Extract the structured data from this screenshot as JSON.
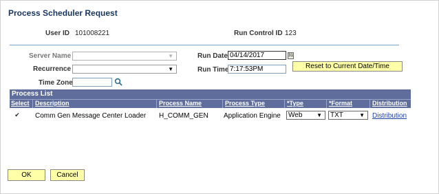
{
  "title": "Process Scheduler Request",
  "header": {
    "user_id_label": "User ID",
    "user_id_value": "101008221",
    "run_control_label": "Run Control ID",
    "run_control_value": "123"
  },
  "form": {
    "server_name_label": "Server Name",
    "server_name_value": "",
    "recurrence_label": "Recurrence",
    "recurrence_value": "",
    "time_zone_label": "Time Zone",
    "time_zone_value": "",
    "run_date_label": "Run Date",
    "run_date_value": "04/14/2017",
    "run_time_label": "Run Time",
    "run_time_value": "7:17:53PM",
    "reset_button": "Reset to Current Date/Time"
  },
  "process_list": {
    "title": "Process List",
    "columns": [
      "Select",
      "Description",
      "Process Name",
      "Process Type",
      "*Type",
      "*Format",
      "Distribution"
    ],
    "rows": [
      {
        "selected": true,
        "description": "Comm Gen Message Center Loader",
        "process_name": "H_COMM_GEN",
        "process_type": "Application Engine",
        "type": "Web",
        "format": "TXT",
        "distribution": "Distribution"
      }
    ]
  },
  "buttons": {
    "ok": "OK",
    "cancel": "Cancel"
  },
  "icons": {
    "calendar": "calendar-icon",
    "lookup": "magnifier-icon",
    "dropdown": "chevron-down-icon"
  },
  "colors": {
    "title": "#17365d",
    "grid_header": "#5e6d9c",
    "button": "#ffffa8",
    "link": "#1f3fa8"
  }
}
